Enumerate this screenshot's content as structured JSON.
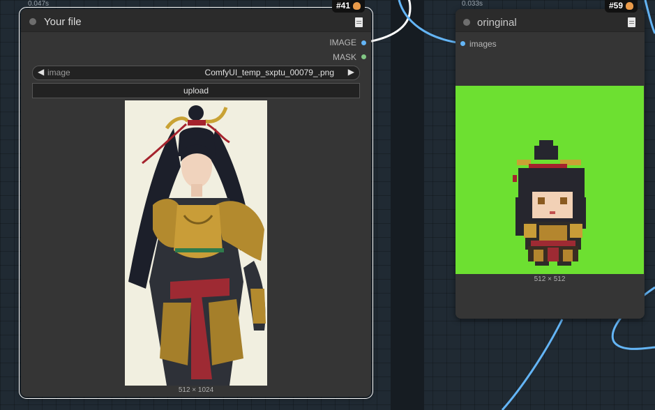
{
  "node_left": {
    "timing": "0.047s",
    "id": "#41",
    "title": "Your file",
    "outputs": [
      {
        "label": "IMAGE",
        "color": "#64b5f6"
      },
      {
        "label": "MASK",
        "color": "#81c784"
      }
    ],
    "image_widget": {
      "label": "image",
      "value": "ComfyUI_temp_sxptu_00079_.png"
    },
    "upload_label": "upload",
    "preview_dims": "512 × 1024"
  },
  "node_right": {
    "timing": "0.033s",
    "id": "#59",
    "title": "oringinal",
    "inputs": [
      {
        "label": "images",
        "color": "#64b5f6"
      }
    ],
    "preview_dims": "512 × 512",
    "preview_bg": "#6de031"
  },
  "colors": {
    "canvas_bg": "#202a33",
    "node_bg": "#353535",
    "wire": "#64b5f6"
  },
  "icons": {
    "node_doc": "document-icon",
    "badge": "fox-icon",
    "arrow_left": "triangle-left-icon",
    "arrow_right": "triangle-right-icon"
  }
}
